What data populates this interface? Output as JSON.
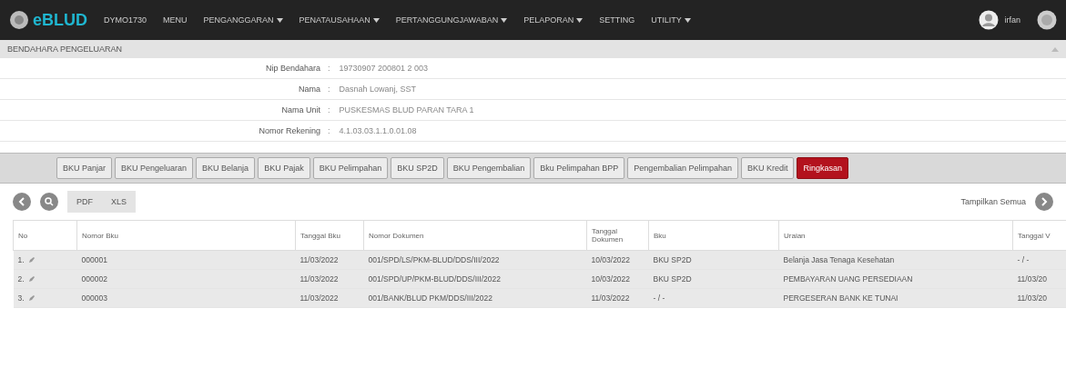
{
  "navbar": {
    "logo": "eBLUD",
    "code": "DYMO1730",
    "menu": [
      {
        "label": "MENU",
        "dropdown": false
      },
      {
        "label": "PENGANGGARAN",
        "dropdown": true
      },
      {
        "label": "PENATAUSAHAAN",
        "dropdown": true
      },
      {
        "label": "PERTANGGUNGJAWABAN",
        "dropdown": true
      },
      {
        "label": "PELAPORAN",
        "dropdown": true
      },
      {
        "label": "SETTING",
        "dropdown": false
      },
      {
        "label": "UTILITY",
        "dropdown": true
      }
    ],
    "user": "irfan"
  },
  "breadcrumb": "BENDAHARA PENGELUARAN",
  "info": [
    {
      "label": "Nip Bendahara",
      "separator": ":",
      "value": "19730907 200801 2 003"
    },
    {
      "label": "Nama",
      "separator": ":",
      "value": "Dasnah Lowanj, SST"
    },
    {
      "label": "Nama Unit",
      "separator": ":",
      "value": "PUSKESMAS BLUD PARAN TARA 1"
    },
    {
      "label": "Nomor Rekening",
      "separator": ":",
      "value": "4.1.03.03.1.1.0.01.08"
    }
  ],
  "tabs": [
    {
      "label": "BKU Panjar",
      "selected": false
    },
    {
      "label": "BKU Pengeluaran",
      "selected": false
    },
    {
      "label": "BKU Belanja",
      "selected": false
    },
    {
      "label": "BKU Pajak",
      "selected": false
    },
    {
      "label": "BKU Pelimpahan",
      "selected": false
    },
    {
      "label": "BKU SP2D",
      "selected": false
    },
    {
      "label": "BKU Pengembalian",
      "selected": false
    },
    {
      "label": "Bku Pelimpahan BPP",
      "selected": false
    },
    {
      "label": "Pengembalian Pelimpahan",
      "selected": false
    },
    {
      "label": "BKU Kredit",
      "selected": false
    },
    {
      "label": "Ringkasan",
      "selected": true
    }
  ],
  "toolbar": {
    "exports": [
      "PDF",
      "XLS"
    ],
    "show_all": "Tampilkan Semua"
  },
  "table": {
    "columns": [
      "No",
      "Nomor Bku",
      "Tanggal Bku",
      "Nomor Dokumen",
      "Tanggal Dokumen",
      "Bku",
      "Uraian",
      "Tanggal V"
    ],
    "rows": [
      {
        "cells": [
          "1.",
          "000001",
          "11/03/2022",
          "001/SPD/LS/PKM-BLUD/DDS/III/2022",
          "10/03/2022",
          "BKU SP2D",
          "Belanja Jasa Tenaga Kesehatan",
          "- / -"
        ]
      },
      {
        "cells": [
          "2.",
          "000002",
          "11/03/2022",
          "001/SPD/UP/PKM-BLUD/DDS/III/2022",
          "10/03/2022",
          "BKU SP2D",
          "PEMBAYARAN UANG PERSEDIAAN",
          "11/03/20"
        ]
      },
      {
        "cells": [
          "3.",
          "000003",
          "11/03/2022",
          "001/BANK/BLUD PKM/DDS/III/2022",
          "11/03/2022",
          "- / -",
          "PERGESERAN BANK KE TUNAI",
          "11/03/20"
        ]
      }
    ]
  }
}
